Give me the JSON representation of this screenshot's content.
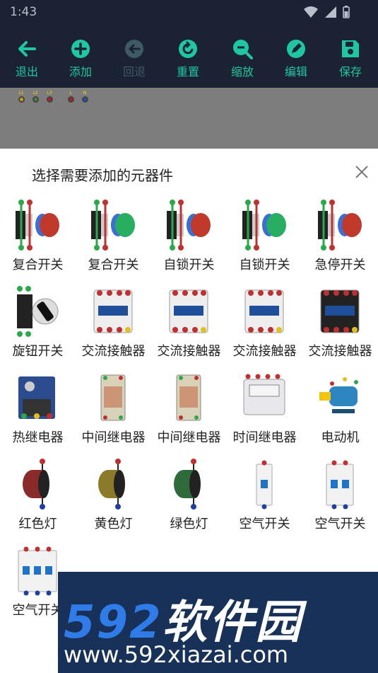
{
  "status": {
    "time": "1:43"
  },
  "toolbar": {
    "exit": "退出",
    "add": "添加",
    "undo": "回退",
    "reset": "重置",
    "zoom": "缩放",
    "edit": "编辑",
    "save": "保存"
  },
  "canvas": {
    "terminals": [
      "L1",
      "L2",
      "L3",
      "L",
      "N"
    ]
  },
  "sheet": {
    "title": "选择需要添加的元器件",
    "items": [
      {
        "label": "复合开关"
      },
      {
        "label": "复合开关"
      },
      {
        "label": "自锁开关"
      },
      {
        "label": "自锁开关"
      },
      {
        "label": "急停开关"
      },
      {
        "label": "旋钮开关"
      },
      {
        "label": "交流接触器"
      },
      {
        "label": "交流接触器"
      },
      {
        "label": "交流接触器"
      },
      {
        "label": "交流接触器"
      },
      {
        "label": "热继电器"
      },
      {
        "label": "中间继电器"
      },
      {
        "label": "中间继电器"
      },
      {
        "label": "时间继电器"
      },
      {
        "label": "电动机"
      },
      {
        "label": "红色灯"
      },
      {
        "label": "黄色灯"
      },
      {
        "label": "绿色灯"
      },
      {
        "label": "空气开关"
      },
      {
        "label": "空气开关"
      },
      {
        "label": "空气开关"
      }
    ]
  },
  "watermark": {
    "brand_num": "592",
    "brand_text": "软件园",
    "url": "www.592xiazai.com"
  }
}
